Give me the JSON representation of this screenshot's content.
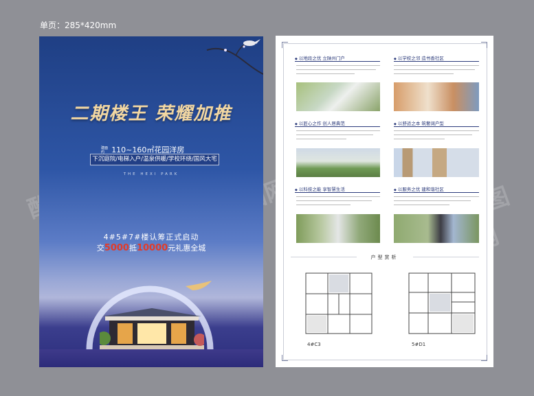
{
  "page": {
    "size_label": "单页：285*420mm"
  },
  "front": {
    "headline": "二期楼王  荣耀加推",
    "spec_tag": "建面约",
    "spec_area": "110~160㎡花园洋房",
    "spec_features": "下沉庭院/电梯入户/温泉供暖/学校环绕/国风大宅",
    "project_en": "THE HEXI PARK",
    "launch": "4#5#7#楼认筹正式启动",
    "promo_prefix": "交",
    "promo_amount1": "5000",
    "promo_mid": "抵",
    "promo_amount2": "10000",
    "promo_suffix": "元礼惠全城"
  },
  "back": {
    "sections": [
      {
        "title": "以地段之优 立陕州门户"
      },
      {
        "title": "以学校之邻 造书香社区"
      },
      {
        "title": "以匠心之作 创人居典范"
      },
      {
        "title": "以舒适之本 筑奢阔户型"
      },
      {
        "title": "以科技之能 享智慧生活"
      },
      {
        "title": "以服务之优 建和谐社区"
      }
    ],
    "floorplan_title": "户型赏析",
    "plans": [
      {
        "name": "4#C3"
      },
      {
        "name": "5#D1"
      }
    ]
  },
  "watermark": "酷图网",
  "colors": {
    "accent_gold": "#f2d7a2",
    "promo_red": "#e23b2a",
    "navy": "#2b3a7a",
    "backdrop": "#8f9096"
  }
}
